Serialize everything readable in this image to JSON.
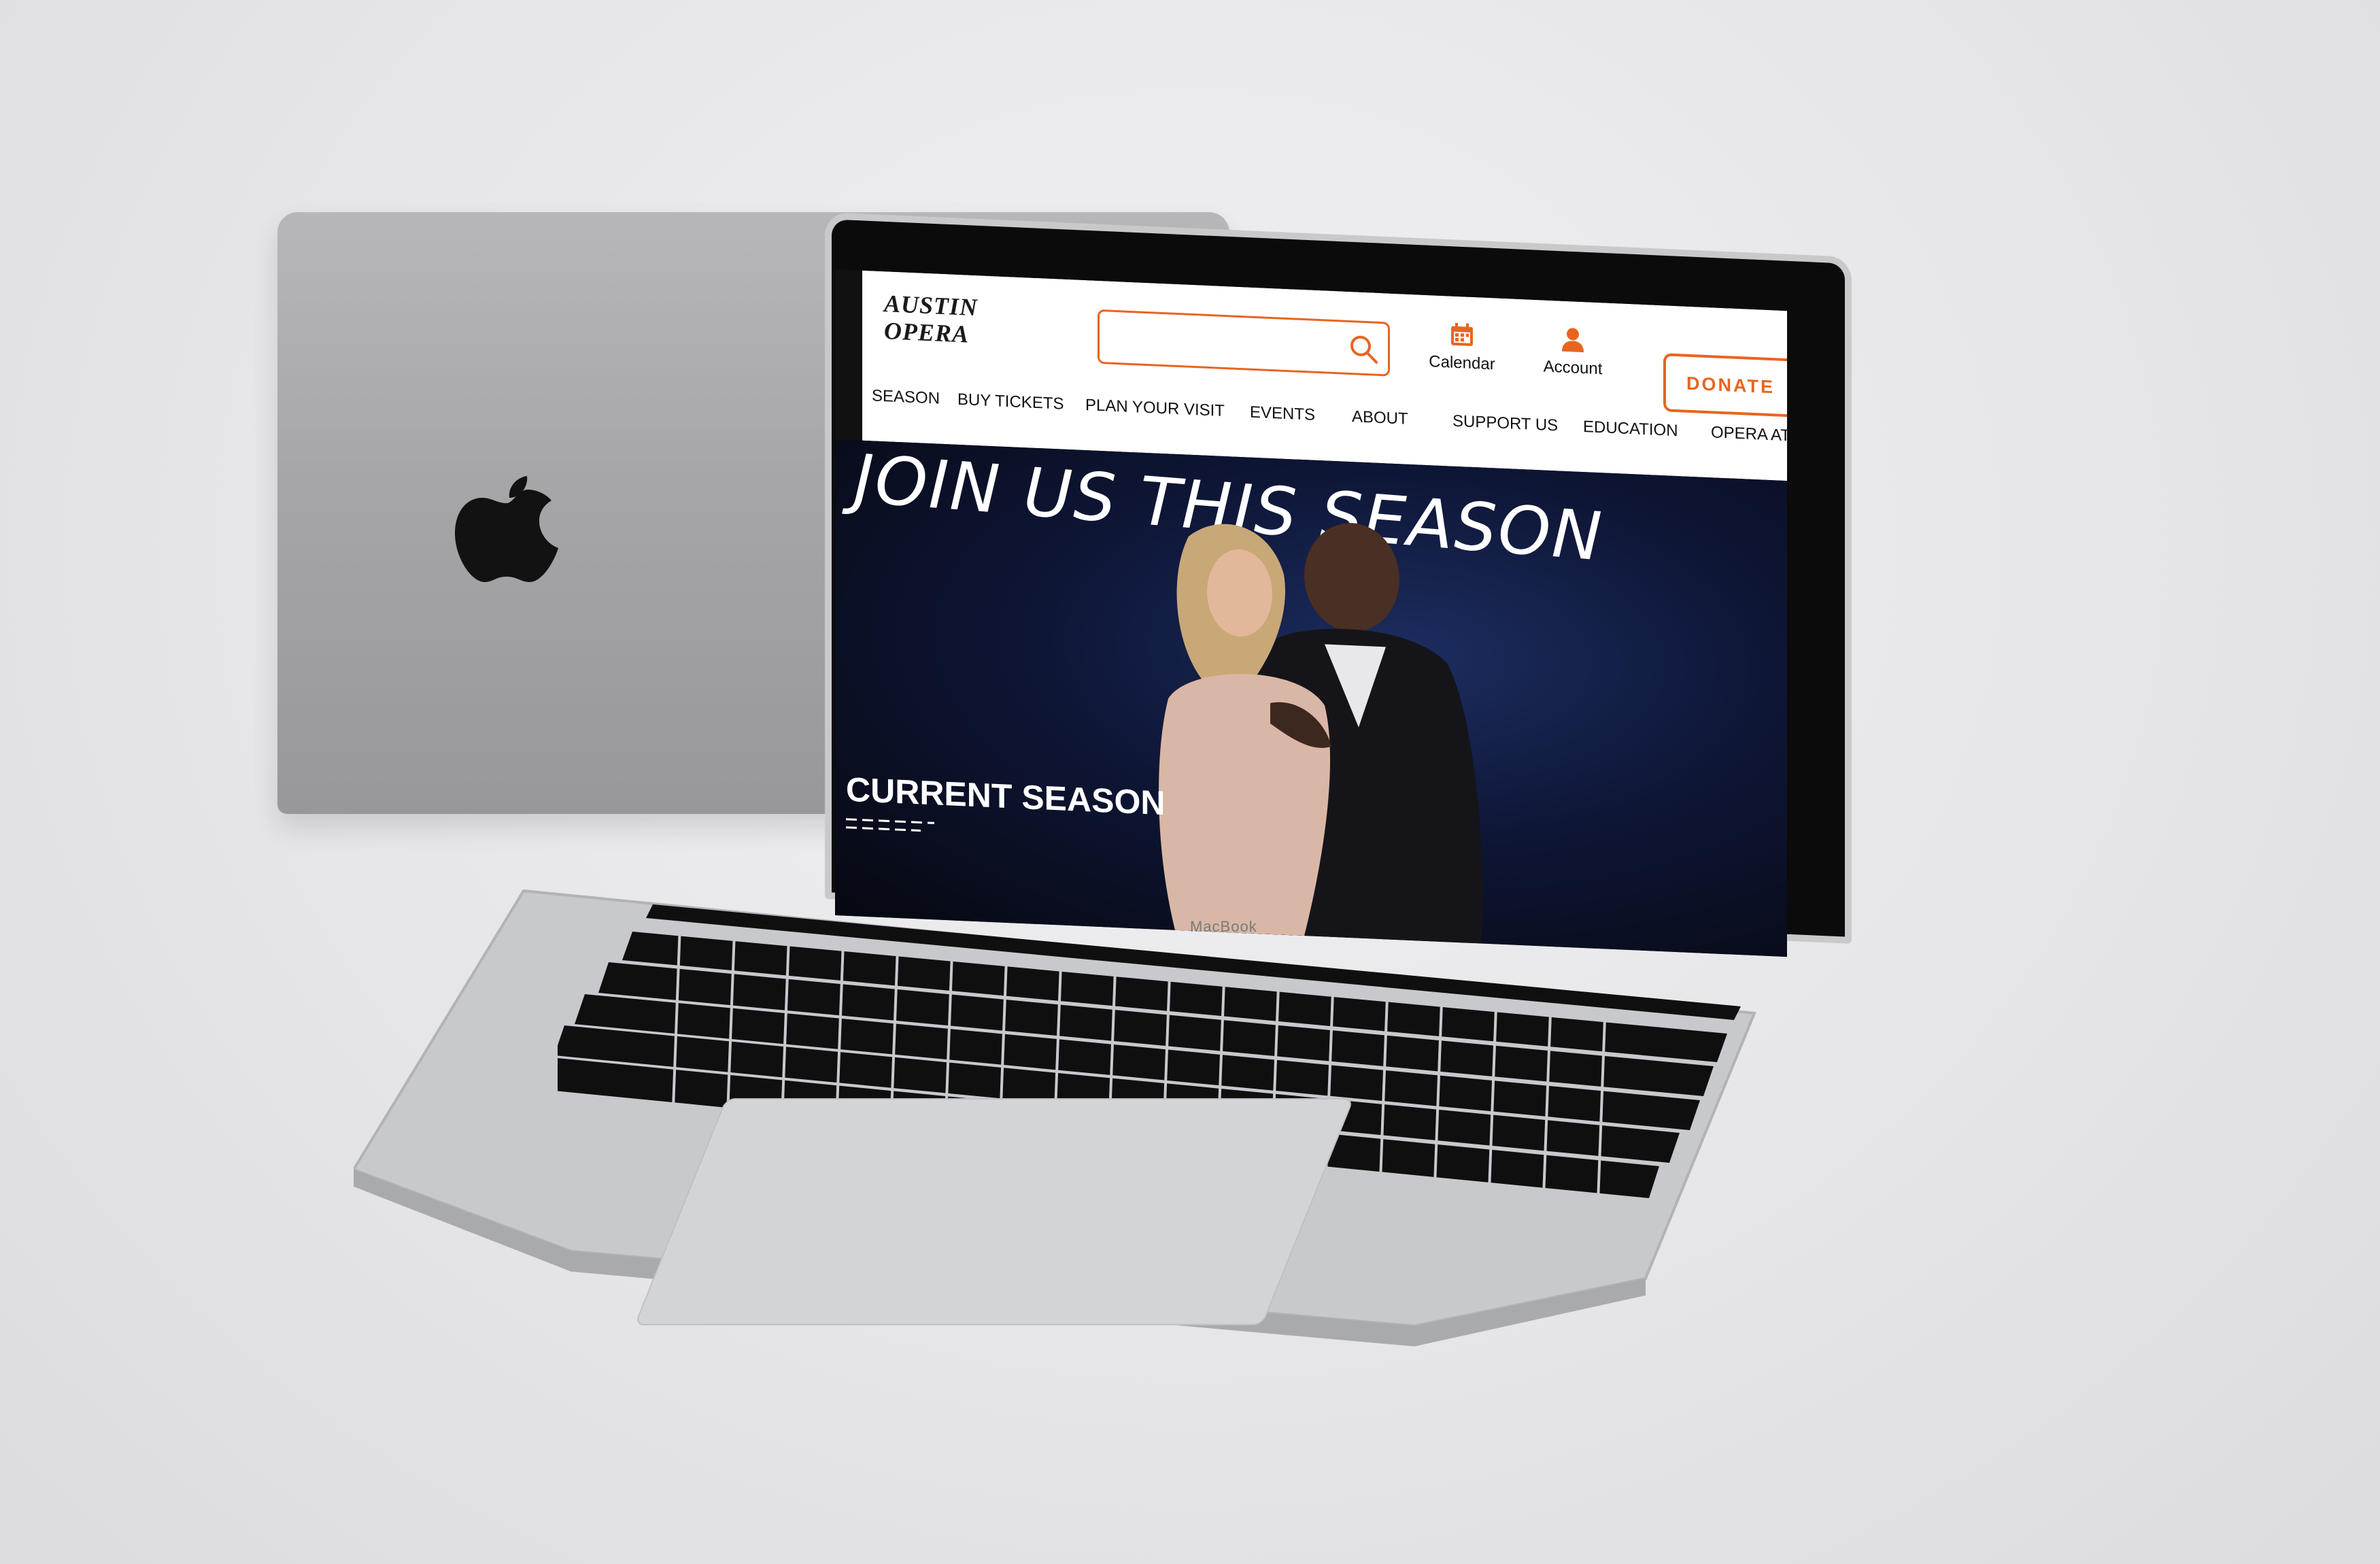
{
  "device": {
    "label": "MacBook"
  },
  "header": {
    "logo_line1": "AUSTIN",
    "logo_line2": "OPERA",
    "search_placeholder": "",
    "calendar_label": "Calendar",
    "account_label": "Account",
    "donate_label": "DONATE"
  },
  "nav": {
    "items": [
      {
        "label": "SEASON"
      },
      {
        "label": "BUY TICKETS"
      },
      {
        "label": "PLAN YOUR VISIT"
      },
      {
        "label": "EVENTS"
      },
      {
        "label": "ABOUT"
      },
      {
        "label": "SUPPORT US"
      },
      {
        "label": "EDUCATION"
      },
      {
        "label": "OPERA ATX"
      }
    ]
  },
  "hero": {
    "headline": "JOIN US THIS SEASON",
    "section_label": "CURRENT SEASON"
  },
  "colors": {
    "accent": "#e8651f",
    "header_bg": "#ffffff",
    "hero_bg": "#0e1636"
  },
  "icons": [
    "search-icon",
    "calendar-icon",
    "account-icon",
    "apple-logo"
  ]
}
